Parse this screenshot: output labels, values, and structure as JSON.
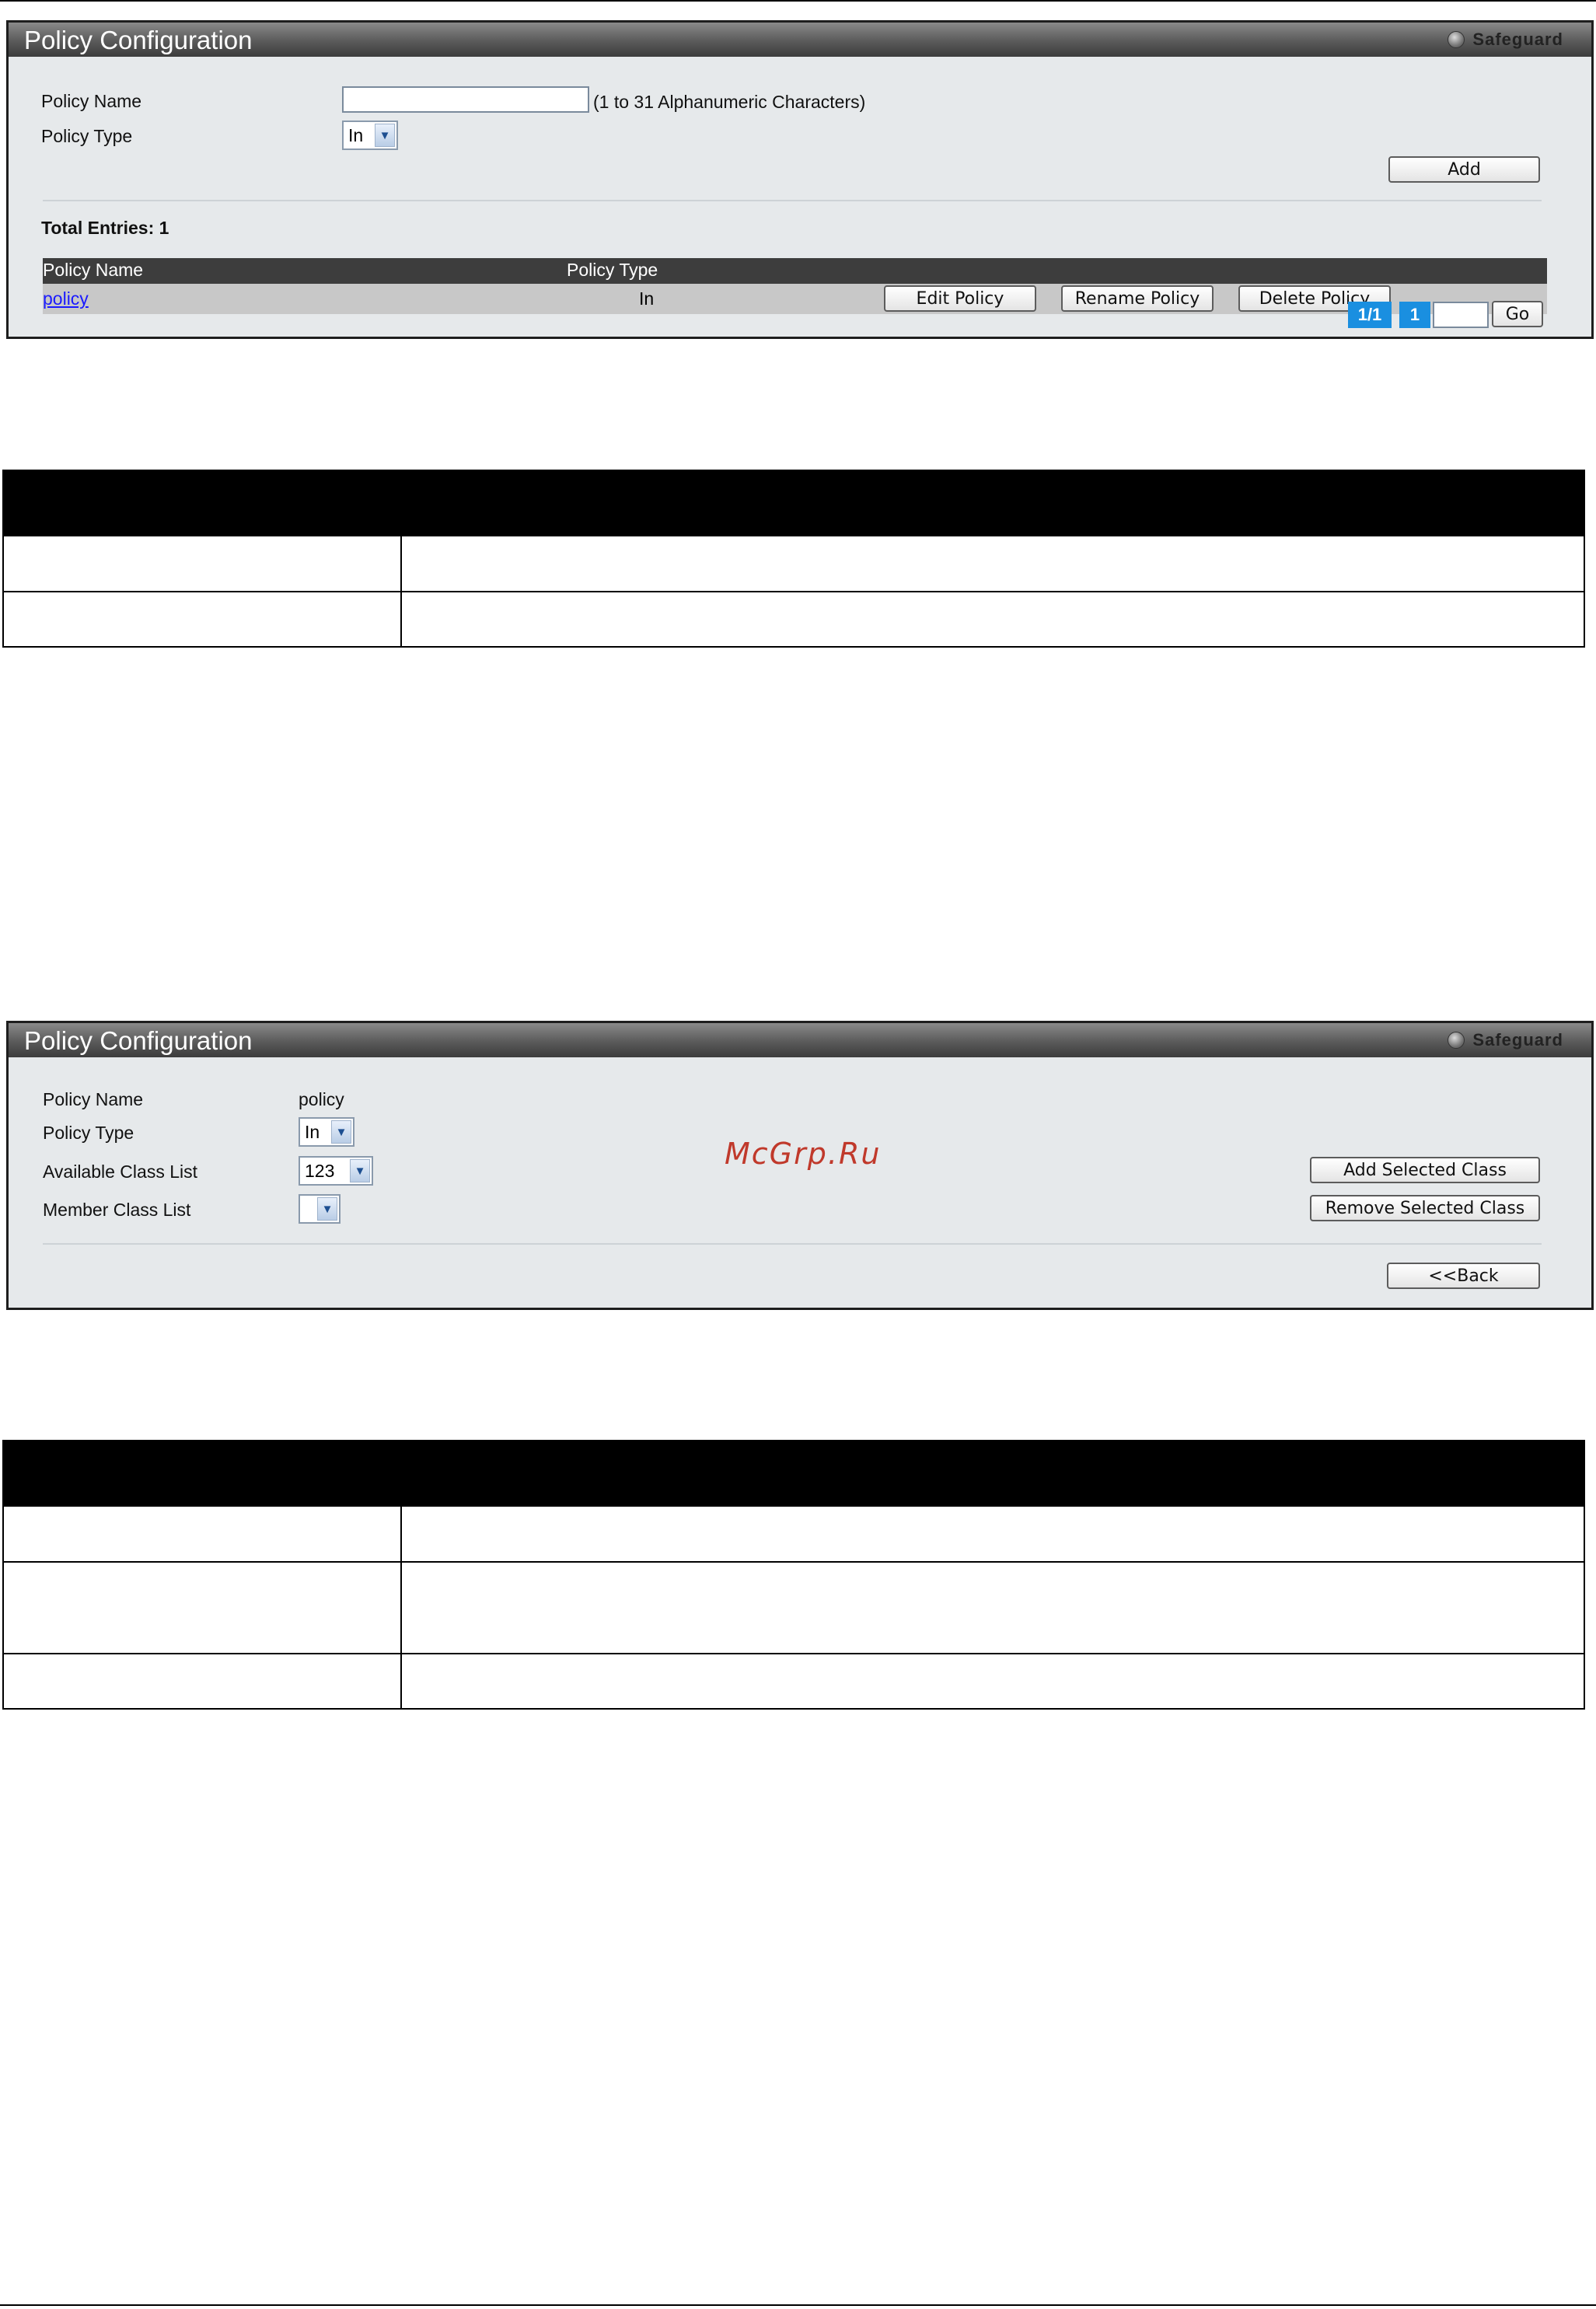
{
  "panel1": {
    "title": "Policy Configuration",
    "safeguard": "Safeguard",
    "policy_name_label": "Policy Name",
    "policy_name_value": "",
    "policy_name_hint": "(1 to 31 Alphanumeric Characters)",
    "policy_type_label": "Policy Type",
    "policy_type_value": "In",
    "add_label": "Add",
    "total_entries": "Total Entries: 1",
    "columns": [
      "Policy Name",
      "Policy Type"
    ],
    "rows": [
      {
        "name": "policy",
        "type": "In",
        "edit": "Edit Policy",
        "rename": "Rename Policy",
        "delete": "Delete Policy"
      }
    ],
    "pager": {
      "pages": "1/1",
      "current": "1",
      "goto_value": "",
      "go_label": "Go"
    }
  },
  "panel2": {
    "title": "Policy Configuration",
    "safeguard": "Safeguard",
    "policy_name_label": "Policy Name",
    "policy_name_value": "policy",
    "policy_type_label": "Policy Type",
    "policy_type_value": "In",
    "available_label": "Available Class List",
    "available_value": "123",
    "member_label": "Member Class List",
    "member_value": "",
    "add_selected_label": "Add Selected Class",
    "remove_selected_label": "Remove Selected Class",
    "back_label": "<<Back"
  },
  "table1": {
    "header": [
      "",
      ""
    ],
    "rows": [
      [
        "",
        ""
      ],
      [
        "",
        ""
      ]
    ]
  },
  "table2": {
    "header": [
      "",
      ""
    ],
    "rows": [
      [
        "",
        ""
      ],
      [
        "",
        ""
      ],
      [
        "",
        ""
      ]
    ]
  },
  "watermark": "McGrp.Ru",
  "colors": {
    "header_bar": "#3d3d3d",
    "panel_bg": "#e6e9eb",
    "pager_blue": "#1a8fe0",
    "link": "#1a1aff",
    "watermark": "#c0392b"
  }
}
